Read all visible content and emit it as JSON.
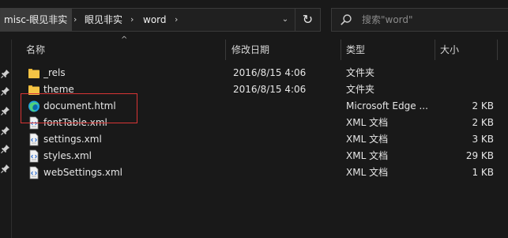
{
  "address_bar": {
    "breadcrumbs": [
      "misc-眼见非实",
      "眼见非实",
      "word"
    ],
    "separator": "›",
    "dropdown": "⌄",
    "refresh": "↻"
  },
  "search": {
    "placeholder": "搜索\"word\""
  },
  "columns": {
    "name": "名称",
    "date": "修改日期",
    "type": "类型",
    "size": "大小",
    "sort_indicator": "^"
  },
  "files": [
    {
      "name": "_rels",
      "date": "2016/8/15 4:06",
      "type": "文件夹",
      "size": "",
      "icon": "folder-icon"
    },
    {
      "name": "theme",
      "date": "2016/8/15 4:06",
      "type": "文件夹",
      "size": "",
      "icon": "folder-icon"
    },
    {
      "name": "document.html",
      "date": "",
      "type": "Microsoft Edge ...",
      "size": "2 KB",
      "icon": "edge-html-icon"
    },
    {
      "name": "fontTable.xml",
      "date": "",
      "type": "XML 文档",
      "size": "2 KB",
      "icon": "xml-file-icon"
    },
    {
      "name": "settings.xml",
      "date": "",
      "type": "XML 文档",
      "size": "3 KB",
      "icon": "xml-file-icon"
    },
    {
      "name": "styles.xml",
      "date": "",
      "type": "XML 文档",
      "size": "29 KB",
      "icon": "xml-file-icon"
    },
    {
      "name": "webSettings.xml",
      "date": "",
      "type": "XML 文档",
      "size": "1 KB",
      "icon": "xml-file-icon"
    }
  ],
  "highlight_color": "#d83535",
  "accent": {
    "folder": "#f4c445",
    "edge": "#1fa0e0"
  }
}
